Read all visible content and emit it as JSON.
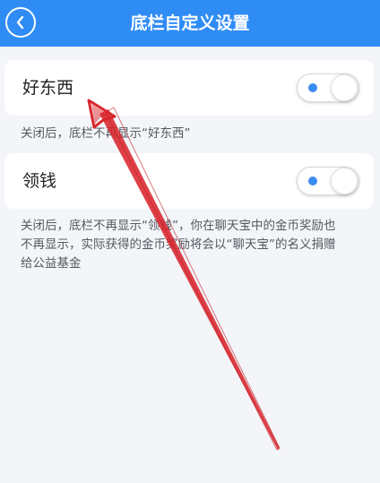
{
  "header": {
    "title": "底栏自定义设置",
    "back_icon": "chevron-left-icon"
  },
  "settings": [
    {
      "label": "好东西",
      "enabled": true,
      "note_lines": [
        "关闭后，底栏不再显示“好东西”"
      ]
    },
    {
      "label": "领钱",
      "enabled": true,
      "note_lines": [
        "关闭后，底栏不再显示“领钱”，你在聊天宝中的金币奖励也",
        "不再显示，实际获得的金币奖励将会以“聊天宝”的名义捐赠",
        "给公益基金"
      ]
    }
  ],
  "colors": {
    "accent": "#2f8cf5",
    "toggle_dot": "#3b8cf0",
    "annotation_arrow": "#d9262c"
  }
}
